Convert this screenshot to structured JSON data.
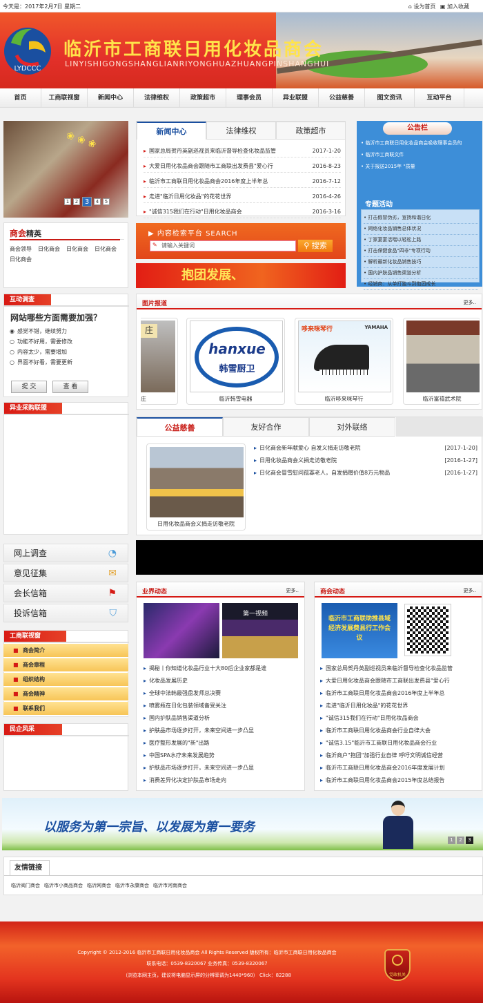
{
  "topbar": {
    "date": "今天是：2017年2月7日 星期二",
    "set_home": "设为首页",
    "bookmark": "加入收藏"
  },
  "banner": {
    "logo_text": "LYDCCC",
    "title": "临沂市工商联日用化妆品商会",
    "subtitle": "LINYISHIGONGSHANGLIANRIYONGHUAZHUANGPINSHANGHUI"
  },
  "nav": [
    "首页",
    "工商联视窗",
    "新闻中心",
    "法律维权",
    "政策超市",
    "理事会员",
    "异业联盟",
    "公益慈善",
    "图文资讯",
    "互动平台"
  ],
  "slider": {
    "pages": [
      "1",
      "2",
      "3",
      "4",
      "5"
    ],
    "active": "3"
  },
  "elite": {
    "title_a": "商会",
    "title_b": "精英",
    "items": [
      "商会领导",
      "日化商会",
      "日化商会",
      "日化商会",
      "日化商会"
    ]
  },
  "survey": {
    "tab": "互动调查",
    "question": "网站哪些方面需要加强？",
    "options": [
      "感觉不错，继续努力",
      "功能不好用，需要修改",
      "内容太少，需要增加",
      "界面不好看，需要更新"
    ],
    "submit": "提 交",
    "view": "查 看"
  },
  "alliance": {
    "title": "异业采购联盟"
  },
  "news_tabs": {
    "tabs": [
      "新闻中心",
      "法律维权",
      "政策超市"
    ],
    "items": [
      {
        "title": "国家总局贺丹英副巡视员来临沂督导检查化妆品监管",
        "date": "2017-1-20"
      },
      {
        "title": "大爱日用化妆品商会跟随市工商联出发费县\"爱心行",
        "date": "2016-8-23"
      },
      {
        "title": "临沂市工商联日用化妆品商会2016年度上半年总",
        "date": "2016-7-12"
      },
      {
        "title": "走进\"临沂日用化妆品\"的花花世界",
        "date": "2016-4-26"
      },
      {
        "title": "\"诚信315我们在行动\"日用化妆品商会",
        "date": "2016-3-16"
      }
    ]
  },
  "notice": {
    "title": "公告栏",
    "items": [
      "临沂市工商联日用化妆品商会吸收理事会员的",
      "临沂市工商联文件",
      "关于报送2015年 \"质量"
    ]
  },
  "topics": {
    "title": "专题活动",
    "items": [
      "打击假冒伪劣，宣扬和谐日化",
      "网络化妆品销售总体状况",
      "丁家宴宴活喘以轻松上路",
      "打击保健食品\"四非\"专项行动",
      "解析最新化妆品销售技巧",
      "国内护肤品销售渠道分析",
      "经销商：从单打独斗到抱团成长"
    ]
  },
  "search": {
    "title": "内容检索平台 SEARCH",
    "placeholder": "请输入关键词",
    "button": "搜索"
  },
  "ad": {
    "text": "抱团发展、"
  },
  "photos": {
    "title": "图片报道",
    "more": "更多..",
    "items": [
      {
        "caption": "庄"
      },
      {
        "caption": "临沂韩雪电器",
        "brand": "hanxue",
        "brand_cn": "韩雪厨卫"
      },
      {
        "caption": "临沂哆来咪琴行",
        "brand": "哆来咪琴行",
        "brand2": "YAMAHA"
      },
      {
        "caption": "临沂富禧武术院"
      }
    ]
  },
  "charity": {
    "tabs": [
      "公益慈善",
      "友好合作",
      "对外联络"
    ],
    "caption": "日用化妆品商会义捐走访敬老院",
    "items": [
      {
        "title": "日化商会新年献爱心 自发义捐走访敬老院",
        "date": "[2017-1-20]"
      },
      {
        "title": "日用化妆品商会义捐走访敬老院",
        "date": "[2016-1-27]"
      },
      {
        "title": "日化商会冒雪慰问孤寡老人，自发捐赠价值8万元物品",
        "date": "[2016-1-27]"
      }
    ]
  },
  "side_buttons": [
    "网上调查",
    "意见征集",
    "会长信箱",
    "投诉信箱"
  ],
  "window_menu": {
    "title": "工商联视窗",
    "items": [
      "商会简介",
      "商会章程",
      "组织结构",
      "商会精神",
      "联系我们"
    ]
  },
  "folk": {
    "title": "民企风采"
  },
  "industry": {
    "title": "业界动态",
    "more": "更多..",
    "img2_text": "第一视频",
    "items": [
      "揭秘丨你知道化妆品行业十大80后企业家都是谁",
      "化妆品发展历史",
      "全球中法韩最强盘发师总决赛",
      "喷雾瓶在日化包装领域备受关注",
      "国内护肤品销售渠道分析",
      "护肤品市场逐步打开，未来空间进一步凸显",
      "医疗整形发展的\"新\"出路",
      "中国SPA水疗未来发展趋势",
      "护肤品市场逐步打开，未来空间进一步凸显",
      "消费差异化决定护肤品市场走向"
    ]
  },
  "commerce": {
    "title": "商会动态",
    "more": "更多..",
    "img_text": "临沂市工商联助推县域经济发展费县行工作会议",
    "items": [
      "国家总局贺丹英副巡视员来临沂督导检查化妆品监管",
      "大爱日用化妆品商会跟随市工商联出发费县\"爱心行",
      "临沂市工商联日用化妆品商会2016年度上半年总",
      "走进\"临沂日用化妆品\"的花花世界",
      "\"诚信315我们在行动\"日用化妆品商会",
      "临沂市工商联日用化妆品商会行业自律大会",
      "\"诚信3.15\"临沂市工商联日用化妆品商会行业",
      "临沂商户\"抱团\"加强行业自律 呼吁文明诚信经营",
      "临沂市工商联日用化妆品商会2016年度发展计划",
      "临沂市工商联日用化妆品商会2015年度总结报告"
    ]
  },
  "slogan": {
    "text": "以服务为第一宗旨、以发展为第一要务",
    "pages": [
      "1",
      "2",
      "3"
    ],
    "active": "3"
  },
  "links": {
    "title": "友情链接",
    "items": [
      "临沂阀门商会",
      "临沂市小商品商会",
      "临沂网商会",
      "临沂市永康商会",
      "临沂市河南商会"
    ]
  },
  "footer": {
    "line1": "Copyright © 2012-2016 临沂市工商联日用化妆品商会 All Rights Reserved 版权所有：临沂市工商联日用化妆品商会",
    "line2": "联系电话：0539-8320067 业务传真：0539-8320067",
    "line3": "（浏览本网主页，建议将电脑显示屏的分辨率调为1440*960） Click：82288",
    "badge": "党政机关"
  }
}
